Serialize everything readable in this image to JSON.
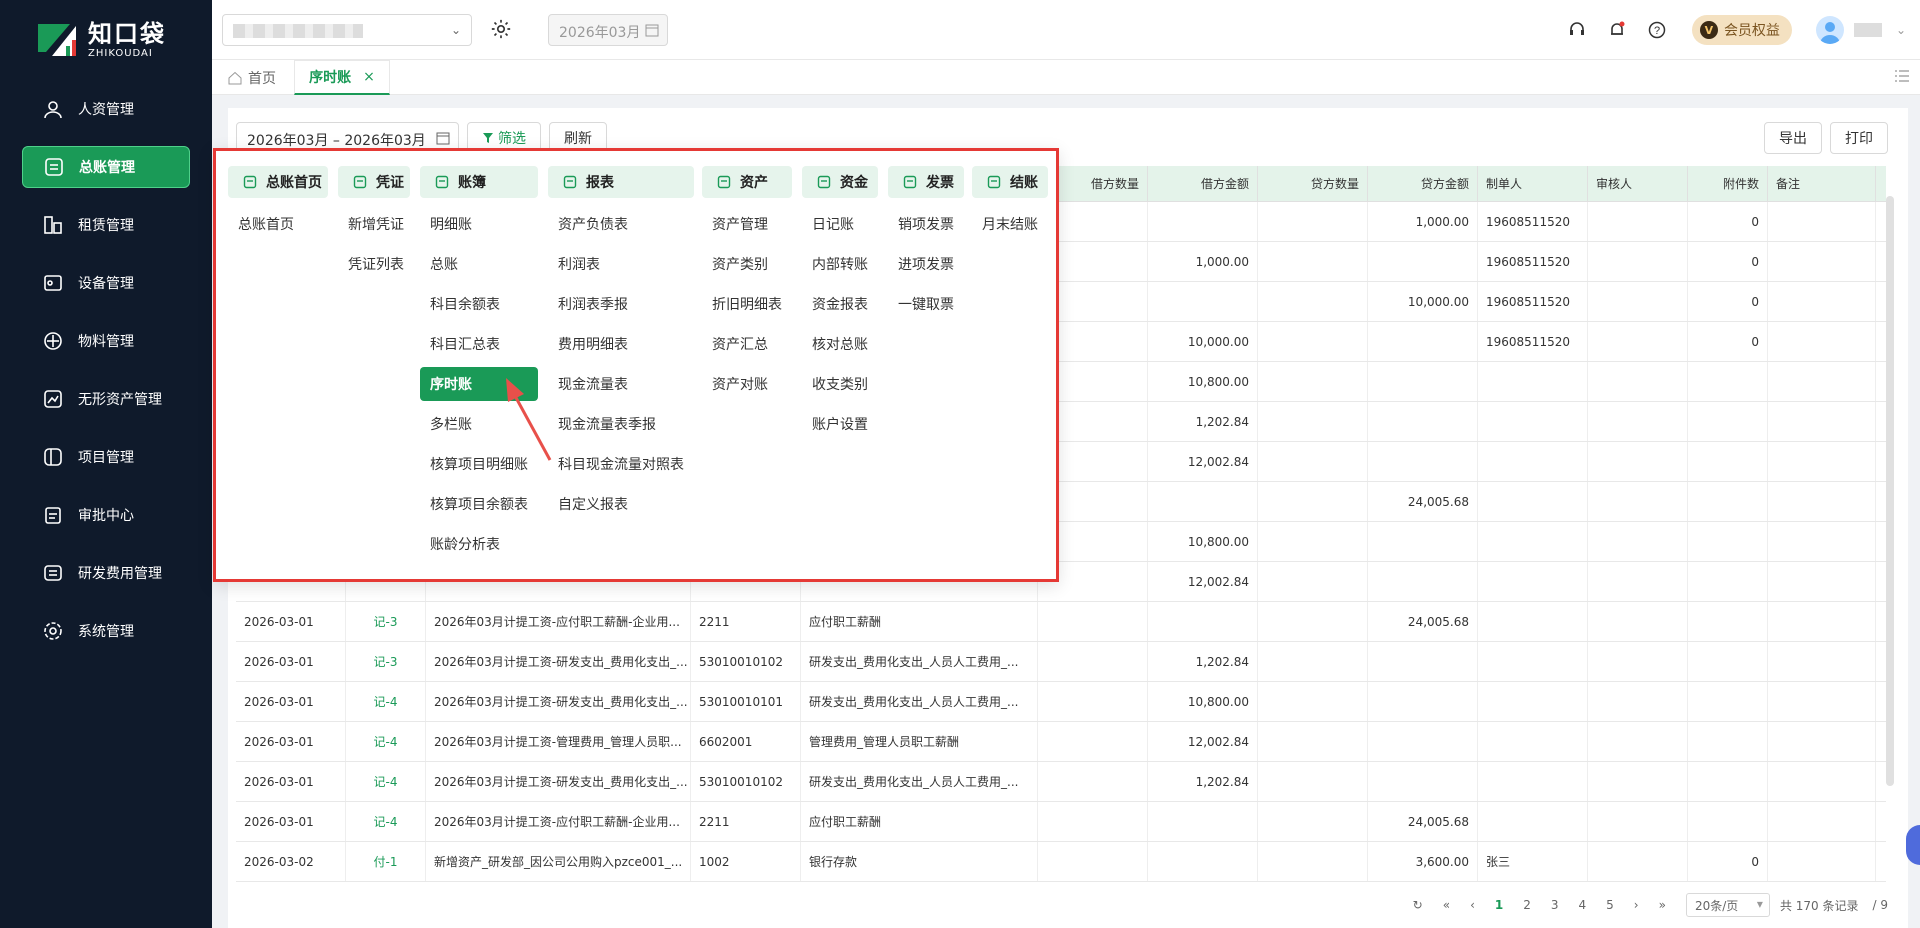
{
  "logo": {
    "cn": "知口袋",
    "en": "ZHIKOUDAI"
  },
  "sidebar": {
    "items": [
      {
        "label": "人资管理",
        "icon": "person-icon"
      },
      {
        "label": "总账管理",
        "icon": "ledger-icon",
        "active": true
      },
      {
        "label": "租赁管理",
        "icon": "lease-icon"
      },
      {
        "label": "设备管理",
        "icon": "device-icon"
      },
      {
        "label": "物料管理",
        "icon": "material-icon"
      },
      {
        "label": "无形资产管理",
        "icon": "asset-icon"
      },
      {
        "label": "项目管理",
        "icon": "project-icon"
      },
      {
        "label": "审批中心",
        "icon": "approval-icon"
      },
      {
        "label": "研发费用管理",
        "icon": "rd-icon"
      },
      {
        "label": "系统管理",
        "icon": "gear-icon"
      }
    ]
  },
  "topbar": {
    "month": "2026年03月",
    "vip_label": "会员权益",
    "vip_badge": "V"
  },
  "tabs": {
    "home": "首页",
    "active": "序时账",
    "close": "×"
  },
  "toolbar": {
    "date_range": "2026年03月 – 2026年03月",
    "filter": "筛选",
    "refresh": "刷新",
    "export": "导出",
    "print": "打印"
  },
  "table": {
    "headers": [
      "借方数量",
      "借方金额",
      "贷方数量",
      "贷方金额",
      "制单人",
      "审核人",
      "附件数",
      "备注"
    ],
    "top_rows": [
      {
        "debit": "",
        "credit": "1,000.00",
        "maker": "19608511520",
        "att": "0"
      },
      {
        "debit": "1,000.00",
        "credit": "",
        "maker": "19608511520",
        "att": "0"
      },
      {
        "debit": "",
        "credit": "10,000.00",
        "maker": "19608511520",
        "att": "0"
      },
      {
        "debit": "10,000.00",
        "credit": "",
        "maker": "19608511520",
        "att": "0"
      },
      {
        "debit": "10,800.00",
        "credit": "",
        "maker": "",
        "att": ""
      },
      {
        "debit": "1,202.84",
        "credit": "",
        "maker": "",
        "att": ""
      },
      {
        "debit": "12,002.84",
        "credit": "",
        "maker": "",
        "att": ""
      },
      {
        "debit": "",
        "credit": "24,005.68",
        "maker": "",
        "att": ""
      },
      {
        "debit": "10,800.00",
        "credit": "",
        "maker": "",
        "att": ""
      },
      {
        "debit": "12,002.84",
        "credit": "",
        "maker": "",
        "att": ""
      }
    ],
    "rows": [
      {
        "date": "2026-03-01",
        "voucher": "记-3",
        "summary": "2026年03月计提工资-应付职工薪酬-企业用...",
        "code": "2211",
        "account": "应付职工薪酬",
        "debit": "",
        "credit": "24,005.68",
        "maker": "",
        "att": ""
      },
      {
        "date": "2026-03-01",
        "voucher": "记-3",
        "summary": "2026年03月计提工资-研发支出_费用化支出_...",
        "code": "53010010102",
        "account": "研发支出_费用化支出_人员人工费用_...",
        "debit": "1,202.84",
        "credit": "",
        "maker": "",
        "att": ""
      },
      {
        "date": "2026-03-01",
        "voucher": "记-4",
        "summary": "2026年03月计提工资-研发支出_费用化支出_...",
        "code": "53010010101",
        "account": "研发支出_费用化支出_人员人工费用_...",
        "debit": "10,800.00",
        "credit": "",
        "maker": "",
        "att": ""
      },
      {
        "date": "2026-03-01",
        "voucher": "记-4",
        "summary": "2026年03月计提工资-管理费用_管理人员职...",
        "code": "6602001",
        "account": "管理费用_管理人员职工薪酬",
        "debit": "12,002.84",
        "credit": "",
        "maker": "",
        "att": ""
      },
      {
        "date": "2026-03-01",
        "voucher": "记-4",
        "summary": "2026年03月计提工资-研发支出_费用化支出_...",
        "code": "53010010102",
        "account": "研发支出_费用化支出_人员人工费用_...",
        "debit": "1,202.84",
        "credit": "",
        "maker": "",
        "att": ""
      },
      {
        "date": "2026-03-01",
        "voucher": "记-4",
        "summary": "2026年03月计提工资-应付职工薪酬-企业用...",
        "code": "2211",
        "account": "应付职工薪酬",
        "debit": "",
        "credit": "24,005.68",
        "maker": "",
        "att": ""
      },
      {
        "date": "2026-03-02",
        "voucher": "付-1",
        "summary": "新增资产_研发部_因公司公用购入pzce001_...",
        "code": "1002",
        "account": "银行存款",
        "debit": "",
        "credit": "3,600.00",
        "maker": "张三",
        "att": "0"
      }
    ]
  },
  "pager": {
    "pages": [
      "1",
      "2",
      "3",
      "4",
      "5"
    ],
    "page_size": "20条/页",
    "total": "共 170 条记录",
    "page_count": "/ 9"
  },
  "menu": {
    "columns": [
      {
        "title": "总账首页",
        "icon": "home-book-icon",
        "items": [
          "总账首页"
        ]
      },
      {
        "title": "凭证",
        "icon": "voucher-icon",
        "items": [
          "新增凭证",
          "凭证列表"
        ]
      },
      {
        "title": "账簿",
        "icon": "book-icon",
        "items": [
          "明细账",
          "总账",
          "科目余额表",
          "科目汇总表",
          "序时账",
          "多栏账",
          "核算项目明细账",
          "核算项目余额表",
          "账龄分析表"
        ]
      },
      {
        "title": "报表",
        "icon": "report-icon",
        "items": [
          "资产负债表",
          "利润表",
          "利润表季报",
          "费用明细表",
          "现金流量表",
          "现金流量表季报",
          "科目现金流量对照表",
          "自定义报表"
        ]
      },
      {
        "title": "资产",
        "icon": "asset-db-icon",
        "items": [
          "资产管理",
          "资产类别",
          "折旧明细表",
          "资产汇总",
          "资产对账"
        ]
      },
      {
        "title": "资金",
        "icon": "fund-icon",
        "items": [
          "日记账",
          "内部转账",
          "资金报表",
          "核对总账",
          "收支类别",
          "账户设置"
        ]
      },
      {
        "title": "发票",
        "icon": "invoice-icon",
        "items": [
          "销项发票",
          "进项发票",
          "一键取票"
        ]
      },
      {
        "title": "结账",
        "icon": "close-account-icon",
        "items": [
          "月末结账"
        ]
      }
    ],
    "active_item": "序时账"
  },
  "colors": {
    "primary": "#1a9a57",
    "sidebar_bg": "#0f1a2b",
    "highlight_border": "#e53935",
    "table_head": "#e4f3ea"
  }
}
